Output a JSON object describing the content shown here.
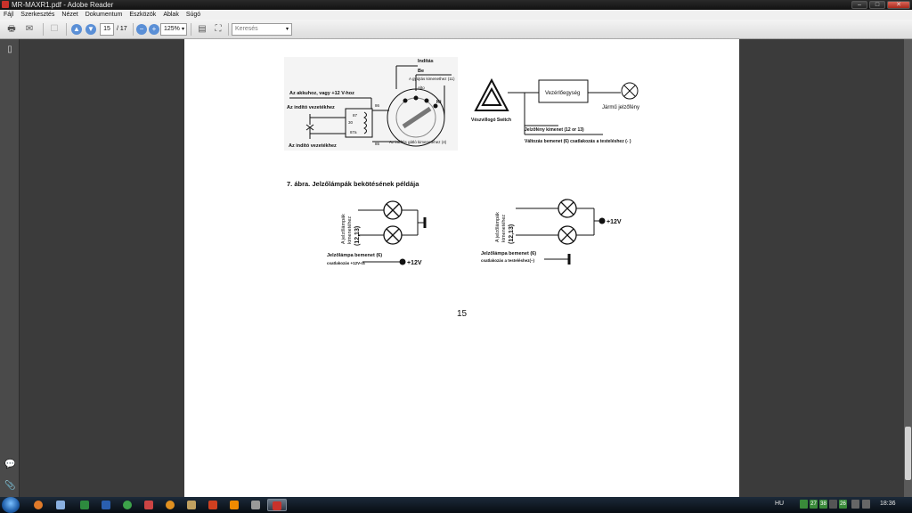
{
  "window": {
    "title": "MR-MAXR1.pdf - Adobe Reader"
  },
  "menu": [
    "Fájl",
    "Szerkesztés",
    "Nézet",
    "Dokumentum",
    "Eszközök",
    "Ablak",
    "Súgó"
  ],
  "toolbar": {
    "page_current": "15",
    "page_total": "/ 17",
    "zoom": "125%",
    "search_placeholder": "Keresés"
  },
  "page": {
    "diagram1": {
      "l_battery": "Az akkuhoz, vagy +12 V-hoz",
      "l_starter_top": "Az indító vezetékhez",
      "l_starter_bottom": "Az indító vezetékhez",
      "p86": "86",
      "p85": "85",
      "p87": "87",
      "p30": "30",
      "p87a": "87a",
      "l_inditas": "Indítás",
      "l_be": "Be",
      "l_gyujtas": "A gyújtás kimenethez (11)",
      "l_alto": "Alto",
      "l_ki": "Ki",
      "l_gatlo": "Az indítás gátló kimenetéhez (4)"
    },
    "diagram2": {
      "l_switch": "Vészvillogó Switch",
      "l_control": "Vezérlőegység",
      "l_vehicle": "Jármű jelzőfény",
      "l_signal_out": "Jelzőfény kimenet (12 or 13)",
      "l_valtozas": "Változás bemenet (6) csatlakozás a testeléshez (- )"
    },
    "caption": "7. ábra. Jelzőlámpák bekötésének példája",
    "diagram3": {
      "l_lamps_1": "A jelzőlámpák",
      "l_lamps_2": "kimenetéhez",
      "l_lamps_3": "(12,13)",
      "l_input": "Jelzőlámpa bemenet (6)",
      "l_conn": "csatlakozás +12V-ra",
      "l_v": "+12V"
    },
    "diagram4": {
      "l_lamps_1": "A jelzőlámpák",
      "l_lamps_2": "kimenetéhez",
      "l_lamps_3": "(12,13)",
      "l_v": "+12V",
      "l_input": "Jelzőlámpa bemenet (6)",
      "l_conn": "csatlakozás a testeléshez(–)"
    },
    "page_number": "15"
  },
  "taskbar": {
    "lang": "HU",
    "badges": [
      "27",
      "38",
      "26"
    ],
    "clock": "18:36"
  },
  "colors": {
    "accent": "#c8322b",
    "page_bg": "#ffffff",
    "viewer_bg": "#3b3b3b"
  }
}
